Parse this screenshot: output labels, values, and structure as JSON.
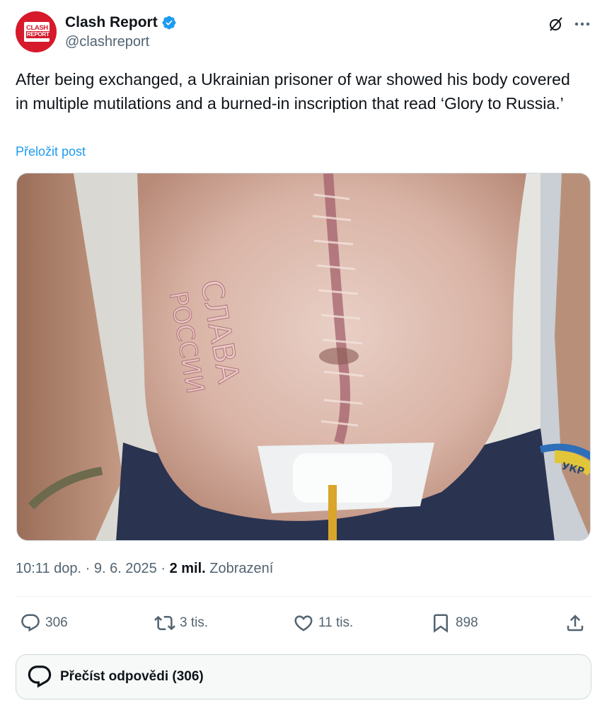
{
  "author": {
    "display_name": "Clash Report",
    "handle": "@clashreport",
    "verified": true,
    "avatar_logo_top": "CLASH",
    "avatar_logo_bottom": "REPORT",
    "avatar_color": "#d6192b",
    "verified_color": "#1d9bf0"
  },
  "tweet": {
    "text": "After being exchanged, a Ukrainian prisoner of war showed his body covered in multiple mutilations and a burned-in inscription that read ‘Glory to Russia.’",
    "translate_label": "Přeložit post",
    "media": {
      "kind": "photo",
      "burned_text_line1": "СЛАВА",
      "burned_text_line2": "РОССИИ",
      "bracelet_text": "УКР"
    }
  },
  "meta": {
    "time": "10:11 dop.",
    "date": "9. 6. 2025",
    "views_count": "2 mil.",
    "views_label": "Zobrazení"
  },
  "actions": {
    "replies": "306",
    "reposts": "3 tis.",
    "likes": "11 tis.",
    "bookmarks": "898"
  },
  "read_replies_label": "Přečíst odpovědi (306)",
  "icons": [
    "verified-badge-icon",
    "grok-icon",
    "more-icon",
    "reply-icon",
    "repost-icon",
    "like-icon",
    "bookmark-icon",
    "share-icon",
    "speech-bubble-icon"
  ]
}
